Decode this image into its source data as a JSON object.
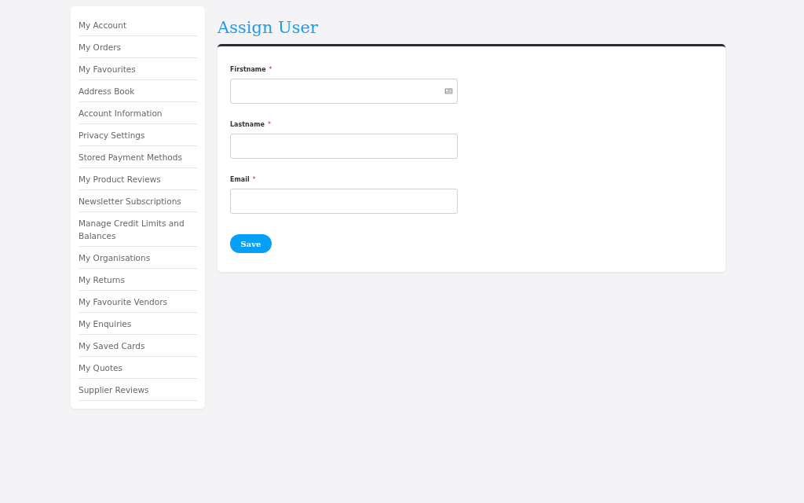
{
  "sidebar": {
    "items": [
      {
        "label": "My Account"
      },
      {
        "label": "My Orders"
      },
      {
        "label": "My Favourites"
      },
      {
        "label": "Address Book"
      },
      {
        "label": "Account Information"
      },
      {
        "label": "Privacy Settings"
      },
      {
        "label": "Stored Payment Methods"
      },
      {
        "label": "My Product Reviews"
      },
      {
        "label": "Newsletter Subscriptions"
      },
      {
        "label": "Manage Credit Limits and Balances"
      },
      {
        "label": "My Organisations"
      },
      {
        "label": "My Returns"
      },
      {
        "label": "My Favourite Vendors"
      },
      {
        "label": "My Enquiries"
      },
      {
        "label": "My Saved Cards"
      },
      {
        "label": "My Quotes"
      },
      {
        "label": "Supplier Reviews"
      }
    ]
  },
  "page_title": "Assign User",
  "form": {
    "fields": [
      {
        "label": "Firstname",
        "required_mark": "*",
        "icon": true
      },
      {
        "label": "Lastname",
        "required_mark": "*",
        "icon": false
      },
      {
        "label": "Email",
        "required_mark": "*",
        "icon": false
      }
    ],
    "save_button": "Save"
  }
}
